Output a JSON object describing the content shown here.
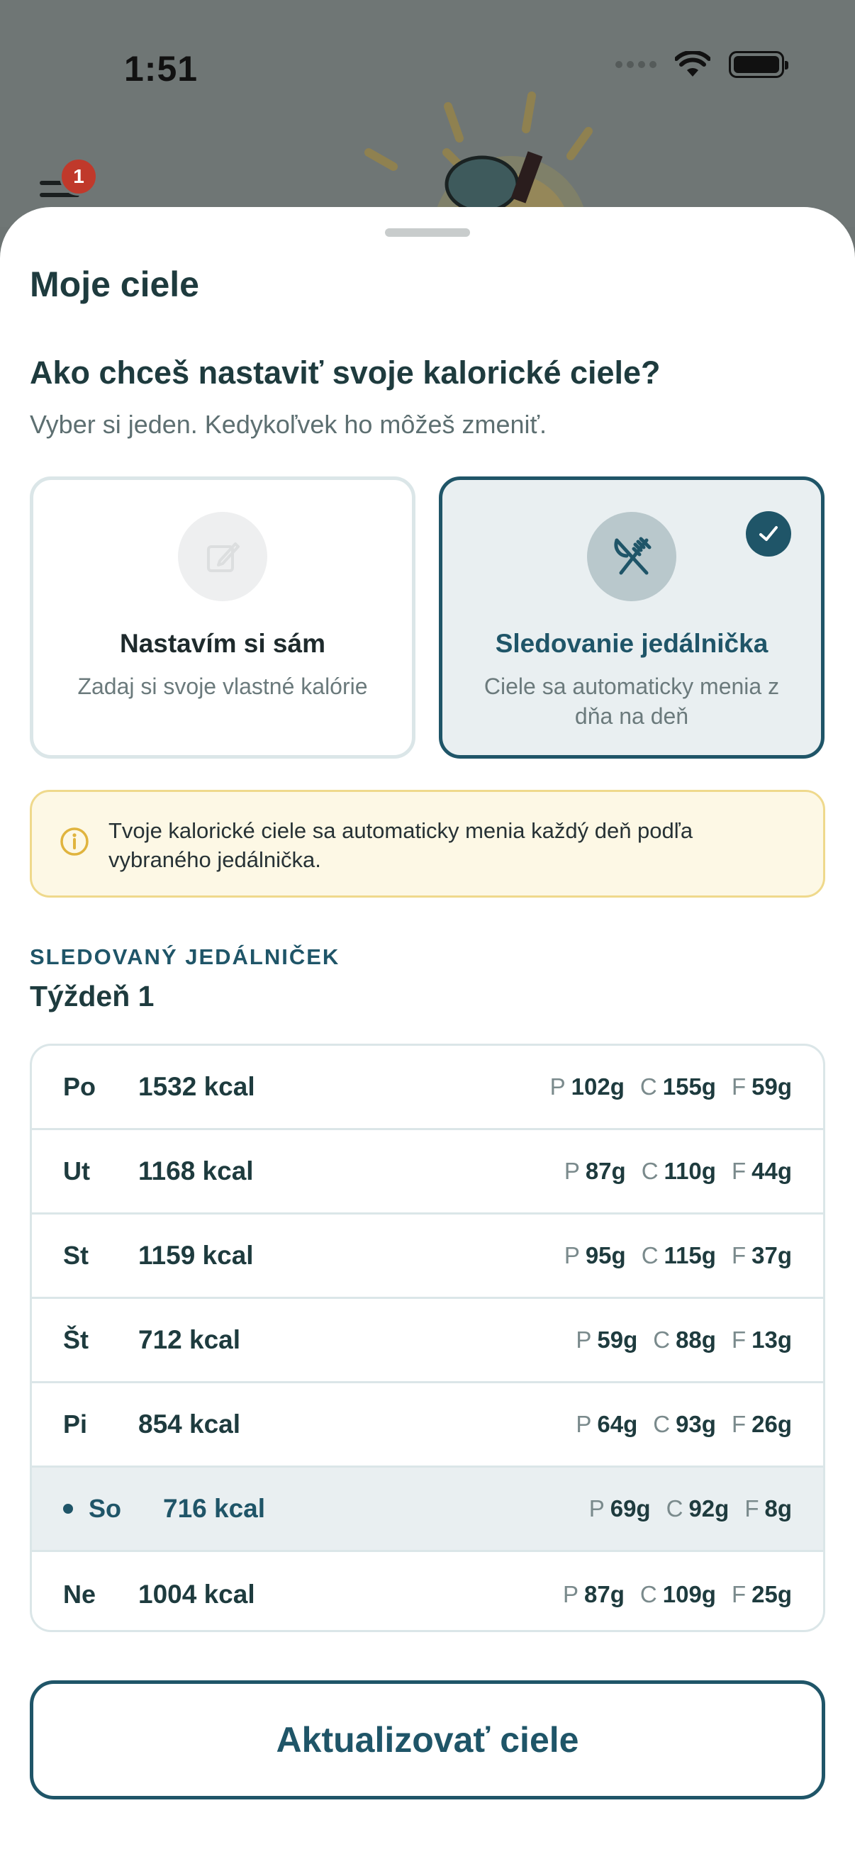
{
  "status_bar": {
    "time": "1:51"
  },
  "background_app": {
    "menu_badge_count": "1"
  },
  "sheet": {
    "title": "Moje ciele",
    "question": "Ako chceš nastaviť svoje kalorické ciele?",
    "hint": "Vyber si jeden. Kedykoľvek ho môžeš zmeniť.",
    "options": [
      {
        "title": "Nastavím si sám",
        "description": "Zadaj si svoje vlastné kalórie",
        "icon": "edit-icon",
        "selected": false
      },
      {
        "title": "Sledovanie jedálnička",
        "description": "Ciele sa automaticky menia z dňa na deň",
        "icon": "fork-knife-icon",
        "selected": true
      }
    ],
    "info": "Tvoje kalorické ciele sa automaticky menia každý deň podľa vybraného jedálnička.",
    "section_label": "SLEDOVANÝ JEDÁLNIČEK",
    "week_title": "Týždeň 1",
    "days": [
      {
        "day": "Po",
        "kcal": "1532 kcal",
        "p": "102g",
        "c": "155g",
        "f": "59g"
      },
      {
        "day": "Ut",
        "kcal": "1168 kcal",
        "p": "87g",
        "c": "110g",
        "f": "44g"
      },
      {
        "day": "St",
        "kcal": "1159 kcal",
        "p": "95g",
        "c": "115g",
        "f": "37g"
      },
      {
        "day": "Št",
        "kcal": "712 kcal",
        "p": "59g",
        "c": "88g",
        "f": "13g"
      },
      {
        "day": "Pi",
        "kcal": "854 kcal",
        "p": "64g",
        "c": "93g",
        "f": "26g"
      },
      {
        "day": "So",
        "kcal": "716 kcal",
        "p": "69g",
        "c": "92g",
        "f": "8g"
      },
      {
        "day": "Ne",
        "kcal": "1004 kcal",
        "p": "87g",
        "c": "109g",
        "f": "25g"
      }
    ],
    "macro_labels": {
      "p": "P",
      "c": "C",
      "f": "F"
    },
    "update_button": "Aktualizovať ciele"
  },
  "colors": {
    "accent": "#1f5568",
    "info_bg": "#fdf8e5",
    "info_border": "#efd98c",
    "current_row": "#e9eff1"
  }
}
